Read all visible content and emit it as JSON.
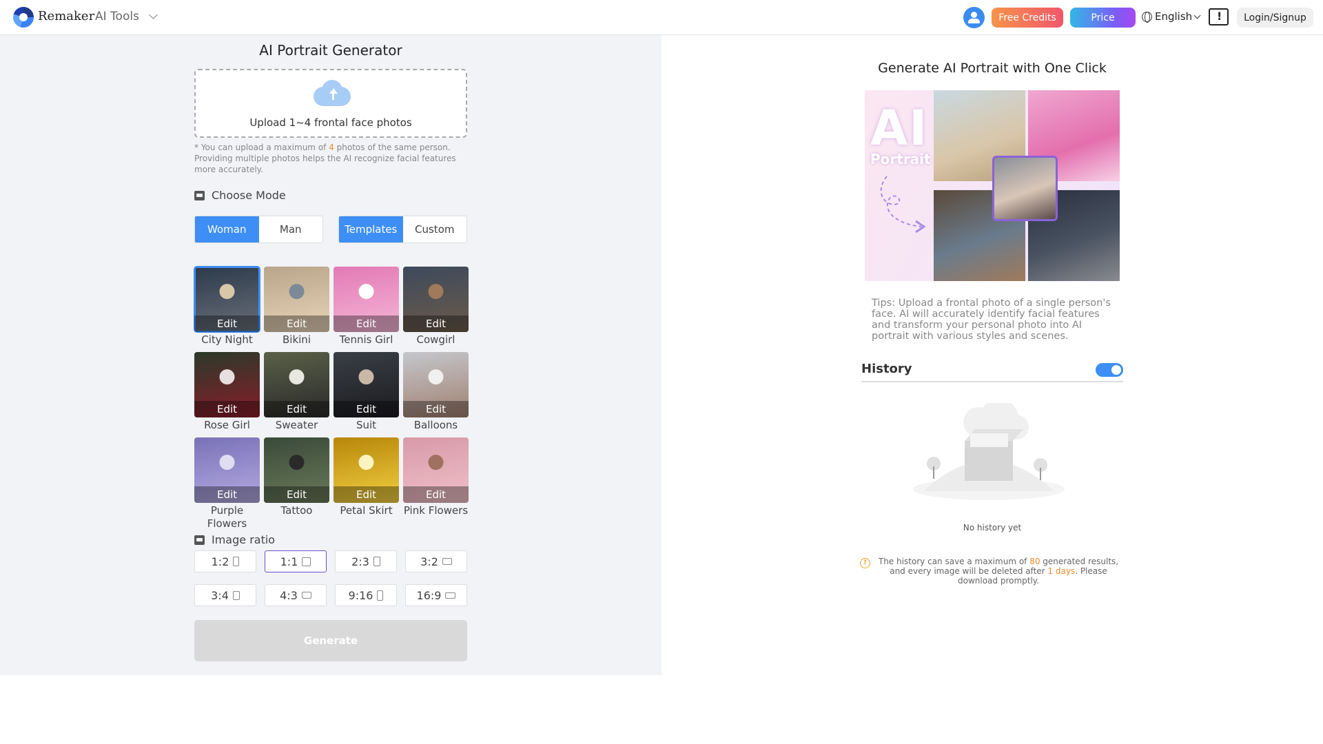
{
  "header": {
    "brand": "Remaker",
    "tools_label": "AI Tools",
    "free_credits": "Free Credits",
    "price": "Price",
    "language": "English",
    "login": "Login/Signup"
  },
  "left": {
    "title": "AI Portrait Generator",
    "upload_text": "Upload 1~4 frontal face photos",
    "note_prefix": "* You can upload a maximum of ",
    "note_count": "4",
    "note_suffix": " photos of the same person. Providing multiple photos helps the AI recognize facial features more accurately.",
    "mode_label": "Choose Mode",
    "gender": {
      "woman": "Woman",
      "man": "Man",
      "selected": "Woman"
    },
    "type": {
      "templates": "Templates",
      "custom": "Custom",
      "selected": "Templates"
    },
    "edit_label": "Edit",
    "templates": [
      {
        "name": "City Night",
        "colors": [
          "#2c3a4a",
          "#6a6f7a",
          "#d9c7a8"
        ]
      },
      {
        "name": "Bikini",
        "colors": [
          "#b9a58a",
          "#e8d4b8",
          "#7b8a96"
        ]
      },
      {
        "name": "Tennis Girl",
        "colors": [
          "#e37ab5",
          "#f4b6d6",
          "#ffffff"
        ]
      },
      {
        "name": "Cowgirl",
        "colors": [
          "#3d4a5c",
          "#6b5a4a",
          "#a07a5a"
        ]
      },
      {
        "name": "Rose Girl",
        "colors": [
          "#2a3a2a",
          "#8a1c2a",
          "#e8e0e0"
        ]
      },
      {
        "name": "Sweater",
        "colors": [
          "#5a6048",
          "#2a2a2a",
          "#e8e8e0"
        ]
      },
      {
        "name": "Suit",
        "colors": [
          "#3a3f46",
          "#1b1b1f",
          "#c9b8a8"
        ]
      },
      {
        "name": "Balloons",
        "colors": [
          "#c5c7cc",
          "#a08070",
          "#f0f0f0"
        ]
      },
      {
        "name": "Purple Flowers",
        "colors": [
          "#7a72b8",
          "#b3a9e0",
          "#e0ddf0"
        ]
      },
      {
        "name": "Tattoo",
        "colors": [
          "#3a4a3a",
          "#6a7a5a",
          "#2a2a2a"
        ]
      },
      {
        "name": "Petal Skirt",
        "colors": [
          "#b8860b",
          "#f0d040",
          "#fff4c0"
        ]
      },
      {
        "name": "Pink Flowers",
        "colors": [
          "#d89aa8",
          "#f0c0c8",
          "#a07060"
        ]
      }
    ],
    "selected_template": "City Night",
    "ratio_label": "Image ratio",
    "ratios": [
      "1:2",
      "1:1",
      "2:3",
      "3:2",
      "3:4",
      "4:3",
      "9:16",
      "16:9"
    ],
    "selected_ratio": "1:1",
    "generate": "Generate"
  },
  "right": {
    "title": "Generate AI Portrait with One Click",
    "banner_ai": "AI",
    "banner_portrait": "Portrait",
    "tips": "Tips: Upload a frontal photo of a single person's face. AI will accurately identify facial features and transform your personal photo into AI portrait with various styles and scenes.",
    "history_title": "History",
    "history_enabled": true,
    "no_history": "No history yet",
    "warn_prefix": "The history can save a maximum of ",
    "warn_count": "80",
    "warn_mid": " generated results, and every image will be deleted after ",
    "warn_days": "1 days",
    "warn_suffix": ". Please download promptly."
  }
}
